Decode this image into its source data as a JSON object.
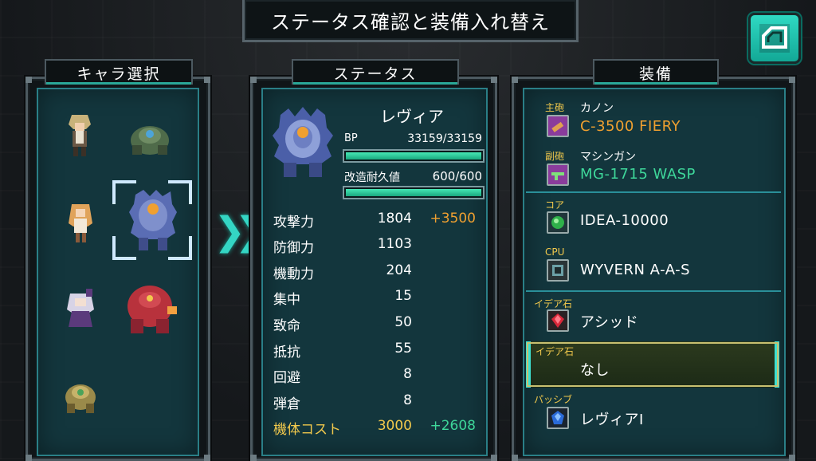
{
  "header": {
    "title": "ステータス確認と装備入れ替え"
  },
  "character_panel": {
    "tab": "キャラ選択"
  },
  "status_panel": {
    "tab": "ステータス",
    "unit_name": "レヴィア",
    "bp_label": "BP",
    "bp_value": "33159/33159",
    "bp_fraction": 1.0,
    "durability_label": "改造耐久値",
    "durability_value": "600/600",
    "durability_fraction": 1.0,
    "stats": [
      {
        "label": "攻撃力",
        "value": "1804",
        "bonus": "+3500"
      },
      {
        "label": "防御力",
        "value": "1103",
        "bonus": ""
      },
      {
        "label": "機動力",
        "value": "204",
        "bonus": ""
      },
      {
        "label": "集中",
        "value": "15",
        "bonus": ""
      },
      {
        "label": "致命",
        "value": "50",
        "bonus": ""
      },
      {
        "label": "抵抗",
        "value": "55",
        "bonus": ""
      },
      {
        "label": "回避",
        "value": "8",
        "bonus": ""
      },
      {
        "label": "弾倉",
        "value": "8",
        "bonus": ""
      },
      {
        "label": "機体コスト",
        "value": "3000",
        "bonus": "+2608"
      }
    ]
  },
  "equipment_panel": {
    "tab": "装備",
    "main_gun": {
      "tag": "主砲",
      "type": "カノン",
      "name": "C-3500 FIERY"
    },
    "sub_gun": {
      "tag": "副砲",
      "type": "マシンガン",
      "name": "MG-1715 WASP"
    },
    "core": {
      "tag": "コア",
      "name": "IDEA-10000"
    },
    "cpu": {
      "tag": "CPU",
      "name": "WYVERN A-A-S"
    },
    "idea1": {
      "tag": "イデア石",
      "name": "アシッド"
    },
    "idea2": {
      "tag": "イデア石",
      "name": "なし"
    },
    "passive": {
      "tag": "パッシブ",
      "name": "レヴィアI"
    }
  },
  "colors": {
    "accent": "#34d6c4",
    "orange": "#f0a030",
    "green": "#3ed79a",
    "gold": "#f2c94c"
  }
}
